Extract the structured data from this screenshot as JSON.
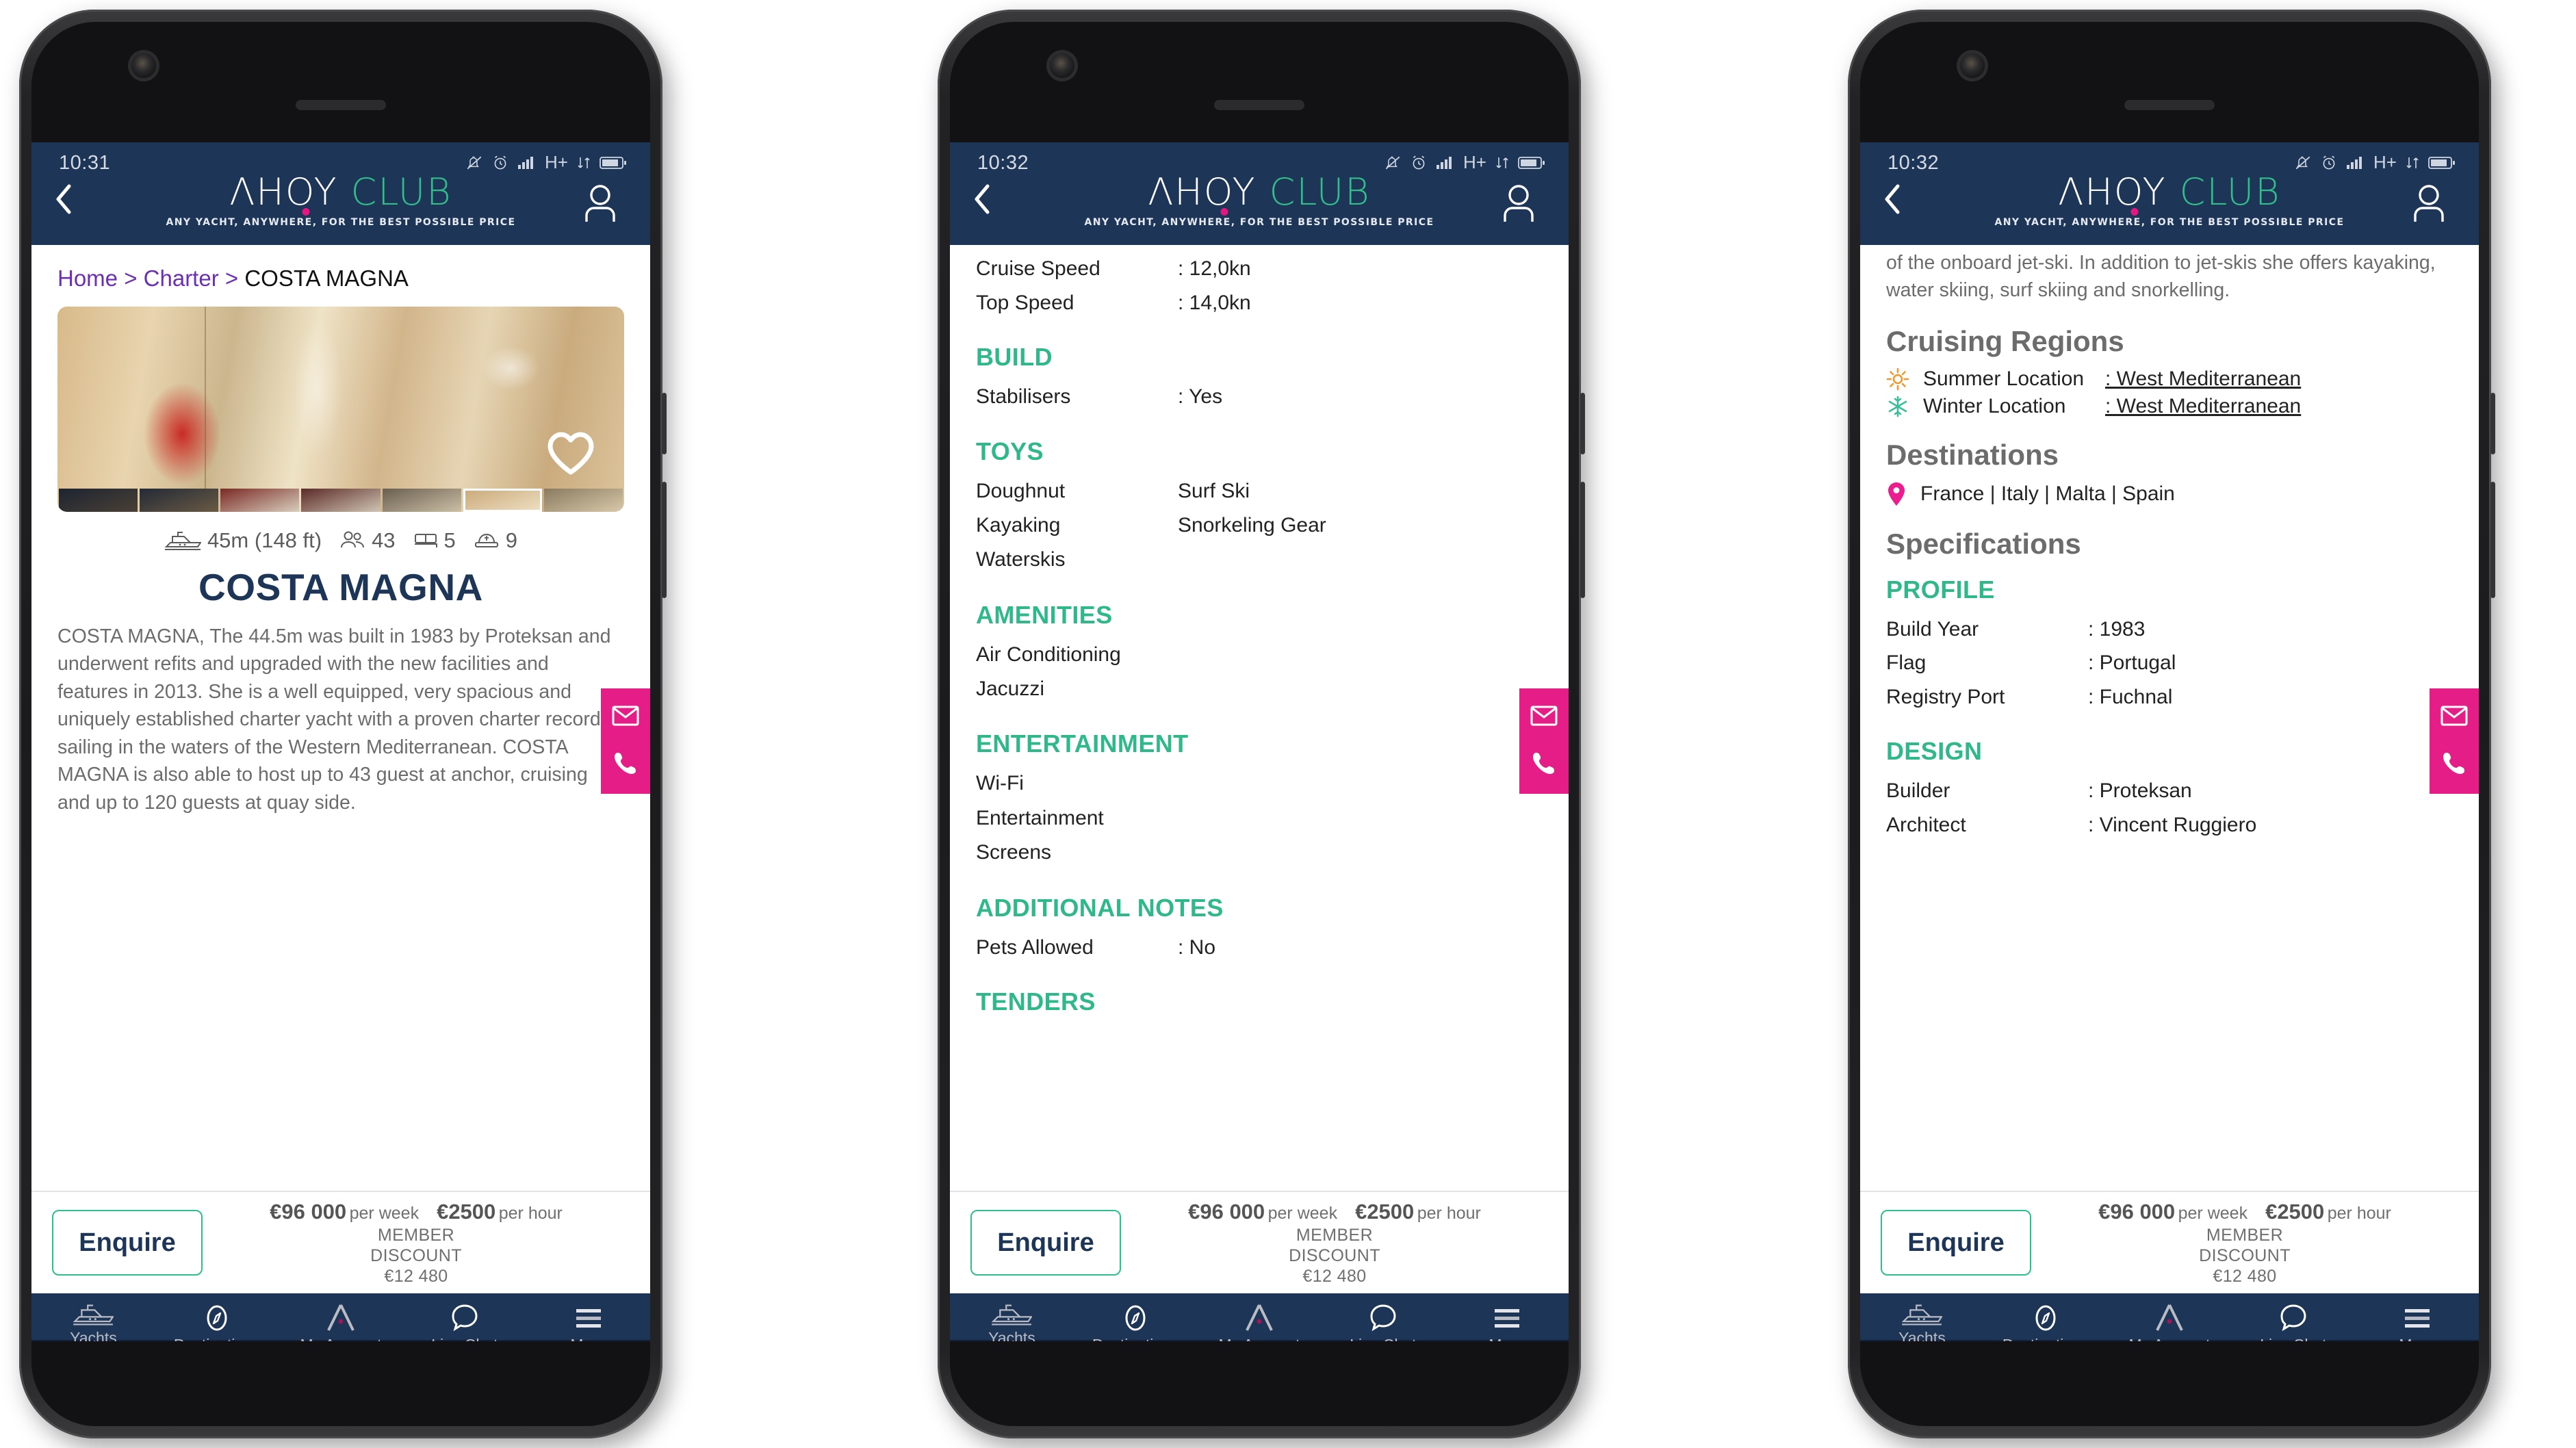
{
  "brand": {
    "logo_primary": "ΛHOY",
    "logo_secondary": "CLUB",
    "tagline": "ANY YACHT, ANYWHERE, FOR THE BEST POSSIBLE PRICE",
    "navy": "#1d3557",
    "green": "#32bd8b",
    "pink": "#e6167f",
    "purple_link": "#6b2fb5"
  },
  "status_bar": {
    "time_phone1": "10:31",
    "time_phone2": "10:32",
    "time_phone3": "10:32",
    "network": "H+",
    "icons": [
      "bell-muted-icon",
      "alarm-icon",
      "signal-bars-icon",
      "network-label",
      "data-transfer-icon",
      "battery-icon"
    ]
  },
  "price_bar": {
    "enquire_label": "Enquire",
    "week_price": "€96 000",
    "week_unit": "per week",
    "hour_price": "€2500",
    "hour_unit": "per hour",
    "member_line1": "MEMBER",
    "member_line2": "DISCOUNT",
    "member_amount": "€12 480"
  },
  "bottom_nav": [
    {
      "label": "Yachts",
      "icon": "yacht-icon"
    },
    {
      "label": "Destinations",
      "icon": "compass-icon"
    },
    {
      "label": "My Account",
      "icon": "account-a-icon"
    },
    {
      "label": "Live Chat",
      "icon": "chat-bubble-icon"
    },
    {
      "label": "More",
      "icon": "hamburger-icon"
    }
  ],
  "contact_rail": [
    {
      "icon": "envelope-icon",
      "name": "email-button"
    },
    {
      "icon": "phone-icon",
      "name": "call-button"
    }
  ],
  "phone1": {
    "breadcrumb": {
      "home": "Home",
      "sep1": ">",
      "charter": "Charter",
      "sep2": ">",
      "current": "COSTA MAGNA"
    },
    "hero": {
      "favourite_icon": "heart-icon",
      "thumbnail_count": 7,
      "active_thumbnail": 6
    },
    "quick_specs": [
      {
        "icon": "yacht-icon",
        "value": "45m (148 ft)"
      },
      {
        "icon": "guests-icon",
        "value": "43"
      },
      {
        "icon": "bed-icon",
        "value": "5"
      },
      {
        "icon": "crew-cap-icon",
        "value": "9"
      }
    ],
    "yacht_name": "COSTA MAGNA",
    "description": "COSTA MAGNA, The 44.5m was built in 1983 by Proteksan and underwent refits and upgraded with the new facilities and features in 2013. She is a well equipped, very spacious and uniquely established charter yacht with a proven charter record, sailing in the waters of the Western Mediterranean. COSTA MAGNA is also able to host up to 43 guest at anchor, cruising and up to 120 guests at quay side."
  },
  "phone2": {
    "performance_rows": [
      {
        "key": "Cruise Speed",
        "value": ": 12,0kn"
      },
      {
        "key": "Top Speed",
        "value": ": 14,0kn"
      }
    ],
    "build": {
      "heading": "BUILD",
      "rows": [
        {
          "key": "Stabilisers",
          "value": ": Yes"
        }
      ]
    },
    "toys": {
      "heading": "TOYS",
      "rows": [
        {
          "c1": "Doughnut",
          "c2": "Surf Ski"
        },
        {
          "c1": "Kayaking",
          "c2": "Snorkeling Gear"
        },
        {
          "c1": "Waterskis",
          "c2": ""
        }
      ]
    },
    "amenities": {
      "heading": "AMENITIES",
      "items": [
        "Air Conditioning",
        "Jacuzzi"
      ]
    },
    "entertainment": {
      "heading": "ENTERTAINMENT",
      "items": [
        "Wi-Fi",
        "Entertainment Screens"
      ]
    },
    "additional_notes": {
      "heading": "ADDITIONAL NOTES",
      "rows": [
        {
          "key": "Pets Allowed",
          "value": ": No"
        }
      ]
    },
    "tenders": {
      "heading": "TENDERS"
    }
  },
  "phone3": {
    "description_tail": "of the onboard jet-ski. In addition to jet-skis she offers kayaking, water skiing, surf skiing and snorkelling.",
    "cruising_regions": {
      "heading": "Cruising Regions",
      "rows": [
        {
          "icon": "sun-icon",
          "key": "Summer Location",
          "value": ": West Mediterranean"
        },
        {
          "icon": "snowflake-icon",
          "key": "Winter Location",
          "value": ": West Mediterranean"
        }
      ]
    },
    "destinations": {
      "heading": "Destinations",
      "icon": "map-pin-icon",
      "value": "France | Italy | Malta | Spain"
    },
    "specifications": {
      "heading": "Specifications",
      "profile": {
        "heading": "PROFILE",
        "rows": [
          {
            "key": "Build Year",
            "value": ": 1983"
          },
          {
            "key": "Flag",
            "value": ": Portugal"
          },
          {
            "key": "Registry Port",
            "value": ": Fuchnal"
          }
        ]
      },
      "design": {
        "heading": "DESIGN",
        "rows": [
          {
            "key": "Builder",
            "value": ": Proteksan"
          },
          {
            "key": "Architect",
            "value": ": Vincent Ruggiero"
          }
        ]
      }
    }
  }
}
